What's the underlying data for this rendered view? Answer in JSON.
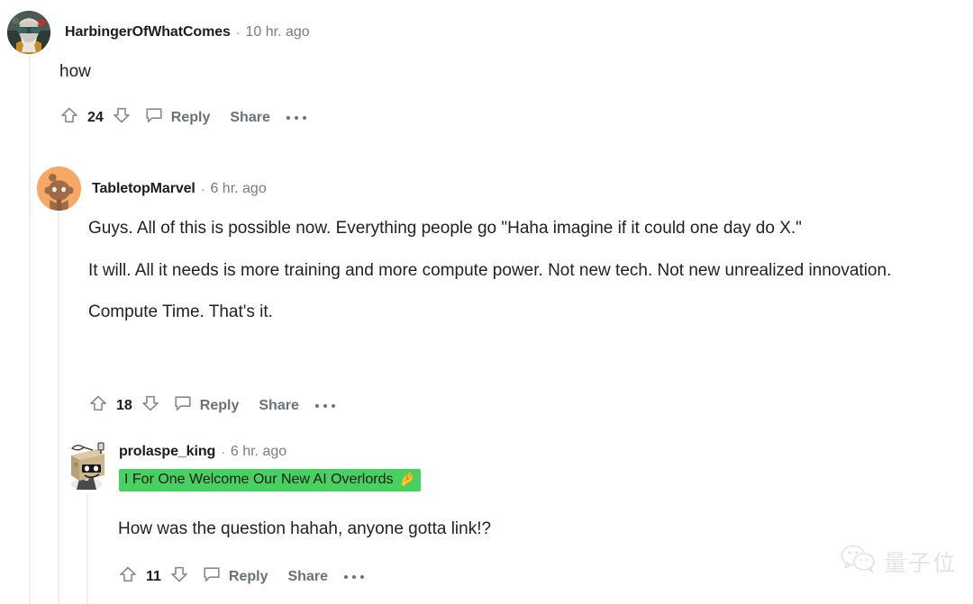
{
  "page": {
    "background": "#ffffff",
    "platform": "reddit-comment-thread"
  },
  "colors": {
    "text": "#222222",
    "username": "#1c1c1c",
    "meta": "#7c7c7c",
    "action": "#6a7178",
    "thread_line": "#edeff1",
    "flair_background": "#46d160",
    "flair_text": "#1a1a1b"
  },
  "comments": [
    {
      "id": "comment-1",
      "depth": 0,
      "avatar": {
        "name": "avatar-harbingerofwhatcomes",
        "type": "photo-portrait",
        "description": "bearded man with sunglasses"
      },
      "username": "HarbingerOfWhatComes",
      "separator": "·",
      "timestamp": "10 hr. ago",
      "paragraphs": [
        "how"
      ],
      "flair": null,
      "actions": {
        "upvote": "upvote-arrow",
        "score": "24",
        "downvote": "downvote-arrow",
        "comment_icon": "comment-bubble-icon",
        "reply_label": "Reply",
        "share_label": "Share",
        "more_label": "more-options-icon"
      }
    },
    {
      "id": "comment-2",
      "depth": 1,
      "avatar": {
        "name": "avatar-tabletopmarvel",
        "type": "reddit-snoo",
        "description": "brown snoo on orange circle"
      },
      "username": "TabletopMarvel",
      "separator": "·",
      "timestamp": "6 hr. ago",
      "paragraphs": [
        "Guys. All of this is possible now. Everything people go \"Haha imagine if it could one day do X.\"",
        "It will. All it needs is more training and more compute power. Not new tech. Not new unrealized innovation.",
        "Compute Time. That's it."
      ],
      "flair": null,
      "actions": {
        "upvote": "upvote-arrow",
        "score": "18",
        "downvote": "downvote-arrow",
        "comment_icon": "comment-bubble-icon",
        "reply_label": "Reply",
        "share_label": "Share",
        "more_label": "more-options-icon"
      }
    },
    {
      "id": "comment-3",
      "depth": 2,
      "avatar": {
        "name": "avatar-prolaspe-king",
        "type": "cardboard-robot",
        "description": "cardboard box head robot with sunglasses"
      },
      "username": "prolaspe_king",
      "separator": "·",
      "timestamp": "6 hr. ago",
      "paragraphs": [
        "How was the question hahah, anyone gotta link!?"
      ],
      "flair": {
        "text": "I For One Welcome Our New AI Overlords",
        "emoji": "🤌"
      },
      "actions": {
        "upvote": "upvote-arrow",
        "score": "11",
        "downvote": "downvote-arrow",
        "comment_icon": "comment-bubble-icon",
        "reply_label": "Reply",
        "share_label": "Share",
        "more_label": "more-options-icon"
      }
    }
  ],
  "watermark": {
    "icon": "wechat-icon",
    "text": "量子位"
  }
}
